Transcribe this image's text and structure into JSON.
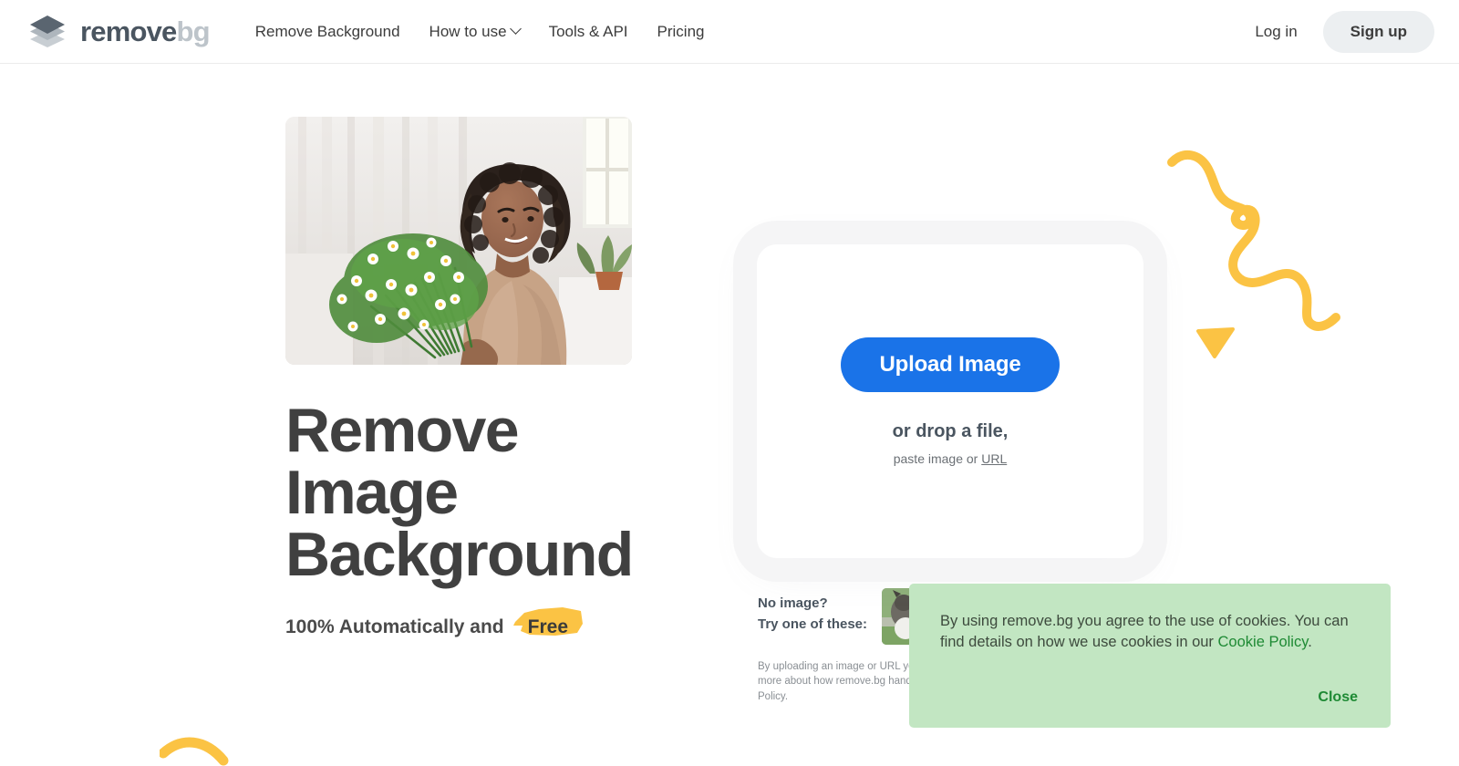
{
  "brand": {
    "word_primary": "remove",
    "word_secondary": "bg",
    "logo_icon": "stacked-diamond-icon"
  },
  "header": {
    "nav": [
      {
        "label": "Remove Background",
        "has_dropdown": false
      },
      {
        "label": "How to use",
        "has_dropdown": true
      },
      {
        "label": "Tools & API",
        "has_dropdown": false
      },
      {
        "label": "Pricing",
        "has_dropdown": false
      }
    ],
    "login_label": "Log in",
    "signup_label": "Sign up"
  },
  "hero": {
    "title_line1": "Remove Image",
    "title_line2": "Background",
    "subtitle_prefix": "100% Automatically and",
    "subtitle_highlight": "Free",
    "photo_alt": "woman-holding-daisy-bouquet-photo"
  },
  "upload": {
    "button_label": "Upload Image",
    "drop_label": "or drop a file,",
    "paste_prefix": "paste image or ",
    "paste_link": "URL"
  },
  "samples": {
    "line1": "No image?",
    "line2": "Try one of these:",
    "thumbnails": [
      {
        "name": "sample-thumbnail-dog-on-grass"
      }
    ],
    "fineprint_line1": "By uploading an image or URL you agree to our Terms of Service. To learn more about how",
    "fineprint_line2": "remove.bg handles your personal data, check our Privacy Policy."
  },
  "cookie_banner": {
    "text_before_link": "By using remove.bg you agree to the use of cookies. You can find details on how we use cookies in our ",
    "link_label": "Cookie Policy",
    "text_after_link": ".",
    "close_label": "Close"
  },
  "colors": {
    "accent_blue": "#1a73e8",
    "brand_dark": "#4a5560",
    "brand_light": "#bdc4ca",
    "heading": "#404040",
    "decoration_yellow": "#fbc344",
    "cookie_bg": "#c2e6c2",
    "cookie_green": "#1e8a34",
    "signup_bg": "#eceff1"
  },
  "decorations": [
    {
      "name": "yellow-squiggle-line"
    },
    {
      "name": "yellow-triangle"
    },
    {
      "name": "yellow-arc"
    }
  ]
}
